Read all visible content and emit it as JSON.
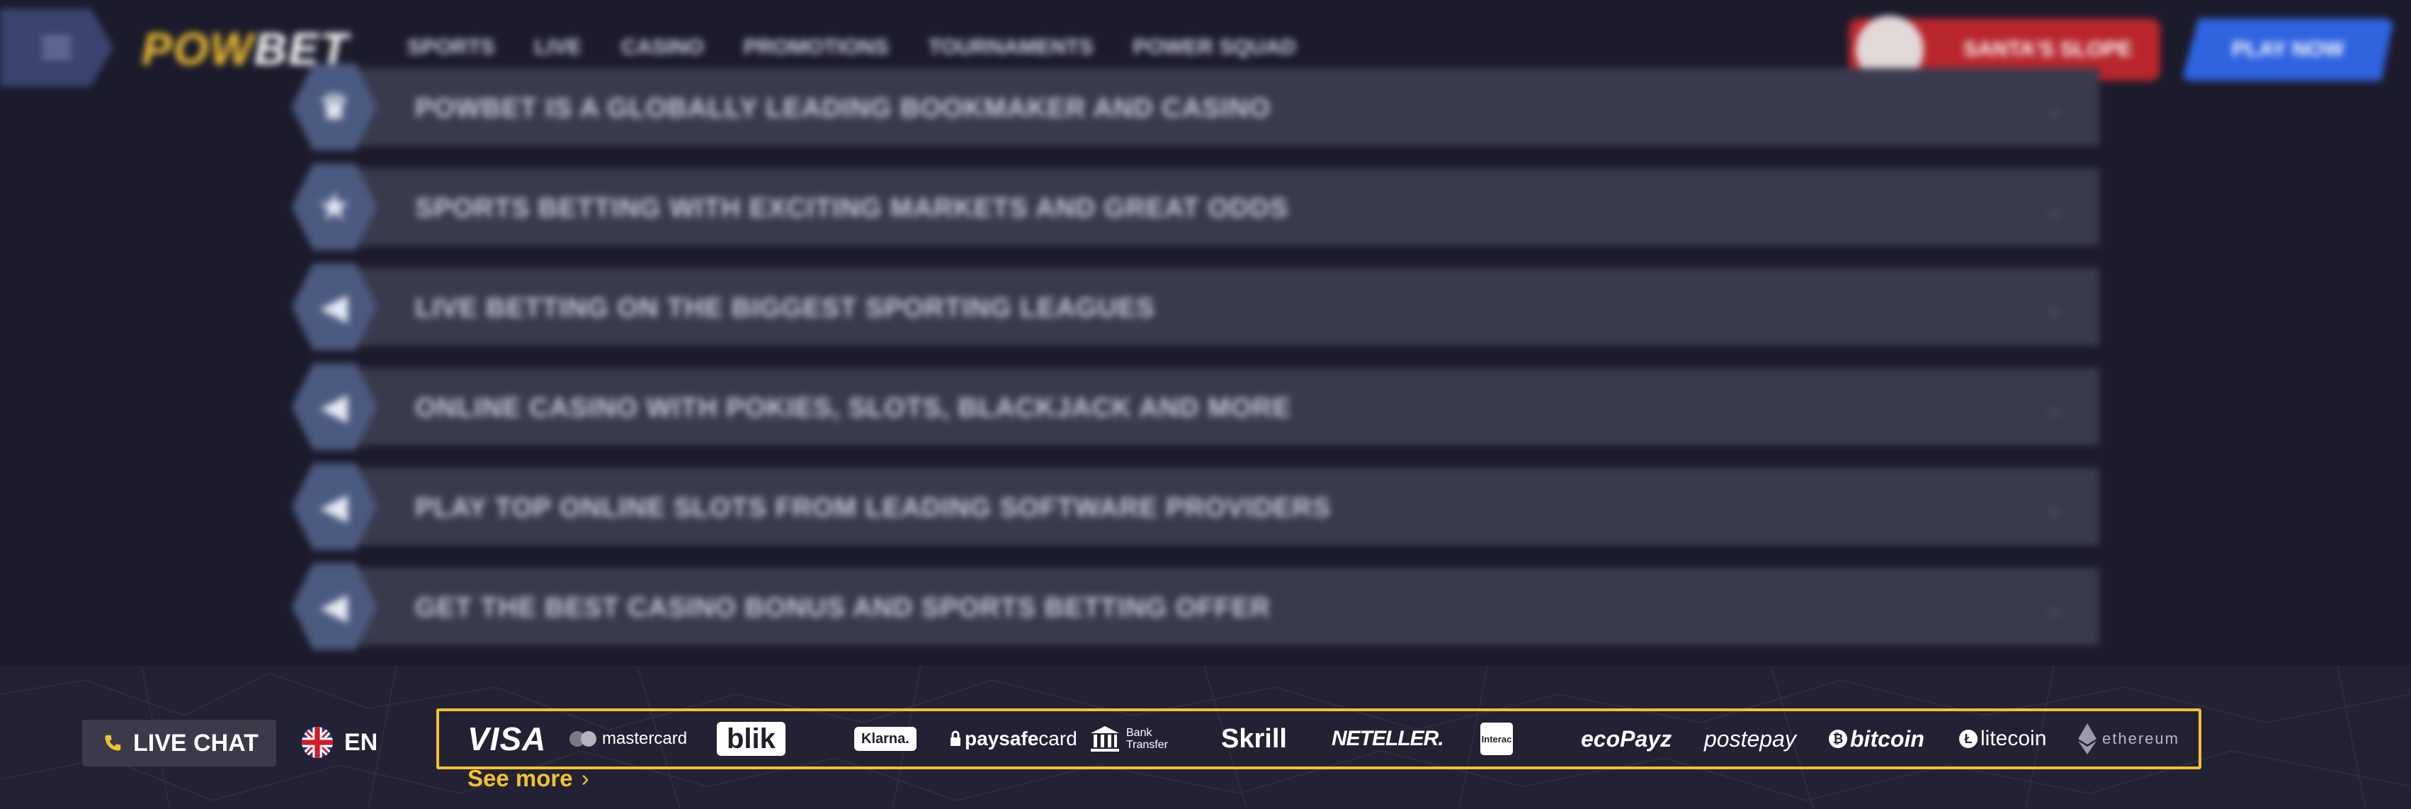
{
  "header": {
    "logo_text_1": "POW",
    "logo_text_2": "BET",
    "nav": [
      "SPORTS",
      "LIVE",
      "CASINO",
      "PROMOTIONS",
      "TOURNAMENTS",
      "POWER SQUAD"
    ],
    "santa_button": "SANTA'S SLOPE",
    "play_button": "PLAY NOW"
  },
  "faq": {
    "items": [
      {
        "icon": "trophy-icon",
        "glyph": "♛",
        "text": "POWBET IS A GLOBALLY LEADING BOOKMAKER AND CASINO"
      },
      {
        "icon": "star-icon",
        "glyph": "★",
        "text": "SPORTS BETTING WITH EXCITING MARKETS AND GREAT ODDS"
      },
      {
        "icon": "play-icon",
        "glyph": "◀",
        "text": "LIVE BETTING ON THE BIGGEST SPORTING LEAGUES"
      },
      {
        "icon": "cards-icon",
        "glyph": "◀",
        "text": "ONLINE CASINO WITH POKIES, SLOTS, BLACKJACK AND MORE"
      },
      {
        "icon": "slot-icon",
        "glyph": "◀",
        "text": "PLAY TOP ONLINE SLOTS FROM LEADING SOFTWARE PROVIDERS"
      },
      {
        "icon": "gift-icon",
        "glyph": "◀",
        "text": "GET THE BEST CASINO BONUS AND SPORTS BETTING OFFER"
      }
    ],
    "chevron": "⌄"
  },
  "footer": {
    "live_chat_label": "LIVE CHAT",
    "language_label": "EN",
    "payments": {
      "visa": "VISA",
      "mastercard": "mastercard",
      "blik": "blik",
      "klarna": "Klarna.",
      "paysafe_1": "paysafe",
      "paysafe_2": "card",
      "bank_1": "Bank",
      "bank_2": "Transfer",
      "skrill": "Skrill",
      "neteller": "NETELLER.",
      "interac": "Interac",
      "ecopayz": "ecoPayz",
      "postepay": "postepay",
      "bitcoin": "bitcoin",
      "litecoin": "litecoin",
      "ethereum": "ethereum"
    },
    "see_more_label": "See more",
    "see_more_chevron": "›"
  },
  "colors": {
    "background": "#1c1b2c",
    "footer": "#232234",
    "accent_yellow": "#f2c230",
    "row": "#3a3a4d"
  }
}
